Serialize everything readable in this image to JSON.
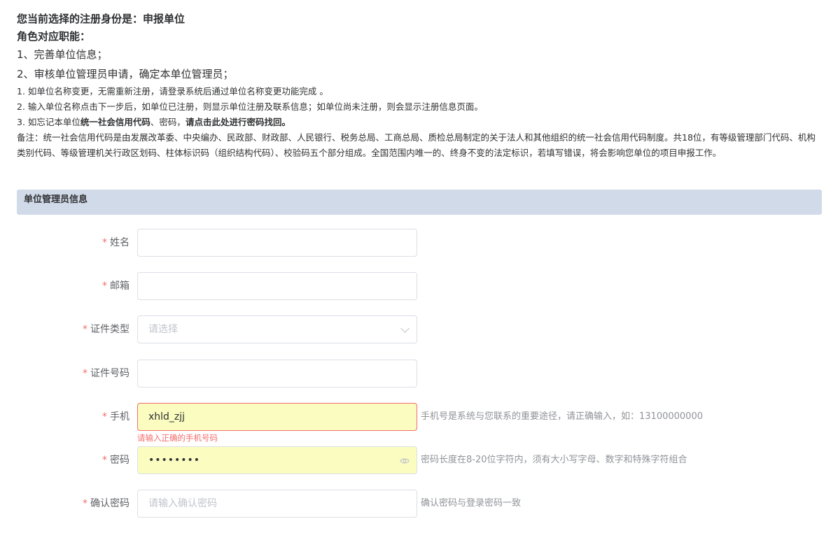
{
  "info": {
    "identity_line": "您当前选择的注册身份是：申报单位",
    "role_title": "角色对应职能：",
    "role_items": [
      "1、完善单位信息；",
      "2、审核单位管理员申请，确定本单位管理员；"
    ],
    "note1": "1. 如单位名称变更，无需重新注册，请登录系统后通过单位名称变更功能完成 。",
    "note2": "2. 输入单位名称点击下一步后，如单位已注册，则显示单位注册及联系信息；如单位尚未注册，则会显示注册信息页面。",
    "note3_prefix": "3. 如忘记本单位",
    "note3_bold1": "统一社会信用代码",
    "note3_mid": "、密码，",
    "note3_bold2": "请点击此处进行密码找回。",
    "remark": "备注：统一社会信用代码是由发展改革委、中央编办、民政部、财政部、人民银行、税务总局、工商总局、质检总局制定的关于法人和其他组织的统一社会信用代码制度。共18位，有等级管理部门代码、机构类别代码、等级管理机关行政区划码、柱体标识码（组织结构代码）、校验码五个部分组成。全国范围内唯一的、终身不变的法定标识，若填写错误，将会影响您单位的项目申报工作。"
  },
  "section": {
    "title": "单位管理员信息"
  },
  "form": {
    "required_mark": "*",
    "name": {
      "label": "姓名",
      "value": ""
    },
    "email": {
      "label": "邮箱",
      "value": ""
    },
    "id_type": {
      "label": "证件类型",
      "placeholder": "请选择"
    },
    "id_number": {
      "label": "证件号码",
      "value": ""
    },
    "phone": {
      "label": "手机",
      "value": "xhld_zjj",
      "error": "请输入正确的手机号码",
      "hint": "手机号是系统与您联系的重要途径，请正确输入，如：13100000000"
    },
    "password": {
      "label": "密码",
      "value": "••••••••",
      "hint": "密码长度在8-20位字符内，须有大小写字母、数字和特殊字符组合"
    },
    "confirm_password": {
      "label": "确认密码",
      "placeholder": "请输入确认密码",
      "hint": "确认密码与登录密码一致"
    }
  },
  "colors": {
    "required": "#f56c6c",
    "section_bg": "#d0dae8",
    "autofill_bg": "#fafcc0"
  },
  "icons": {
    "select": "chevron-down-icon",
    "password": "eye-icon"
  }
}
